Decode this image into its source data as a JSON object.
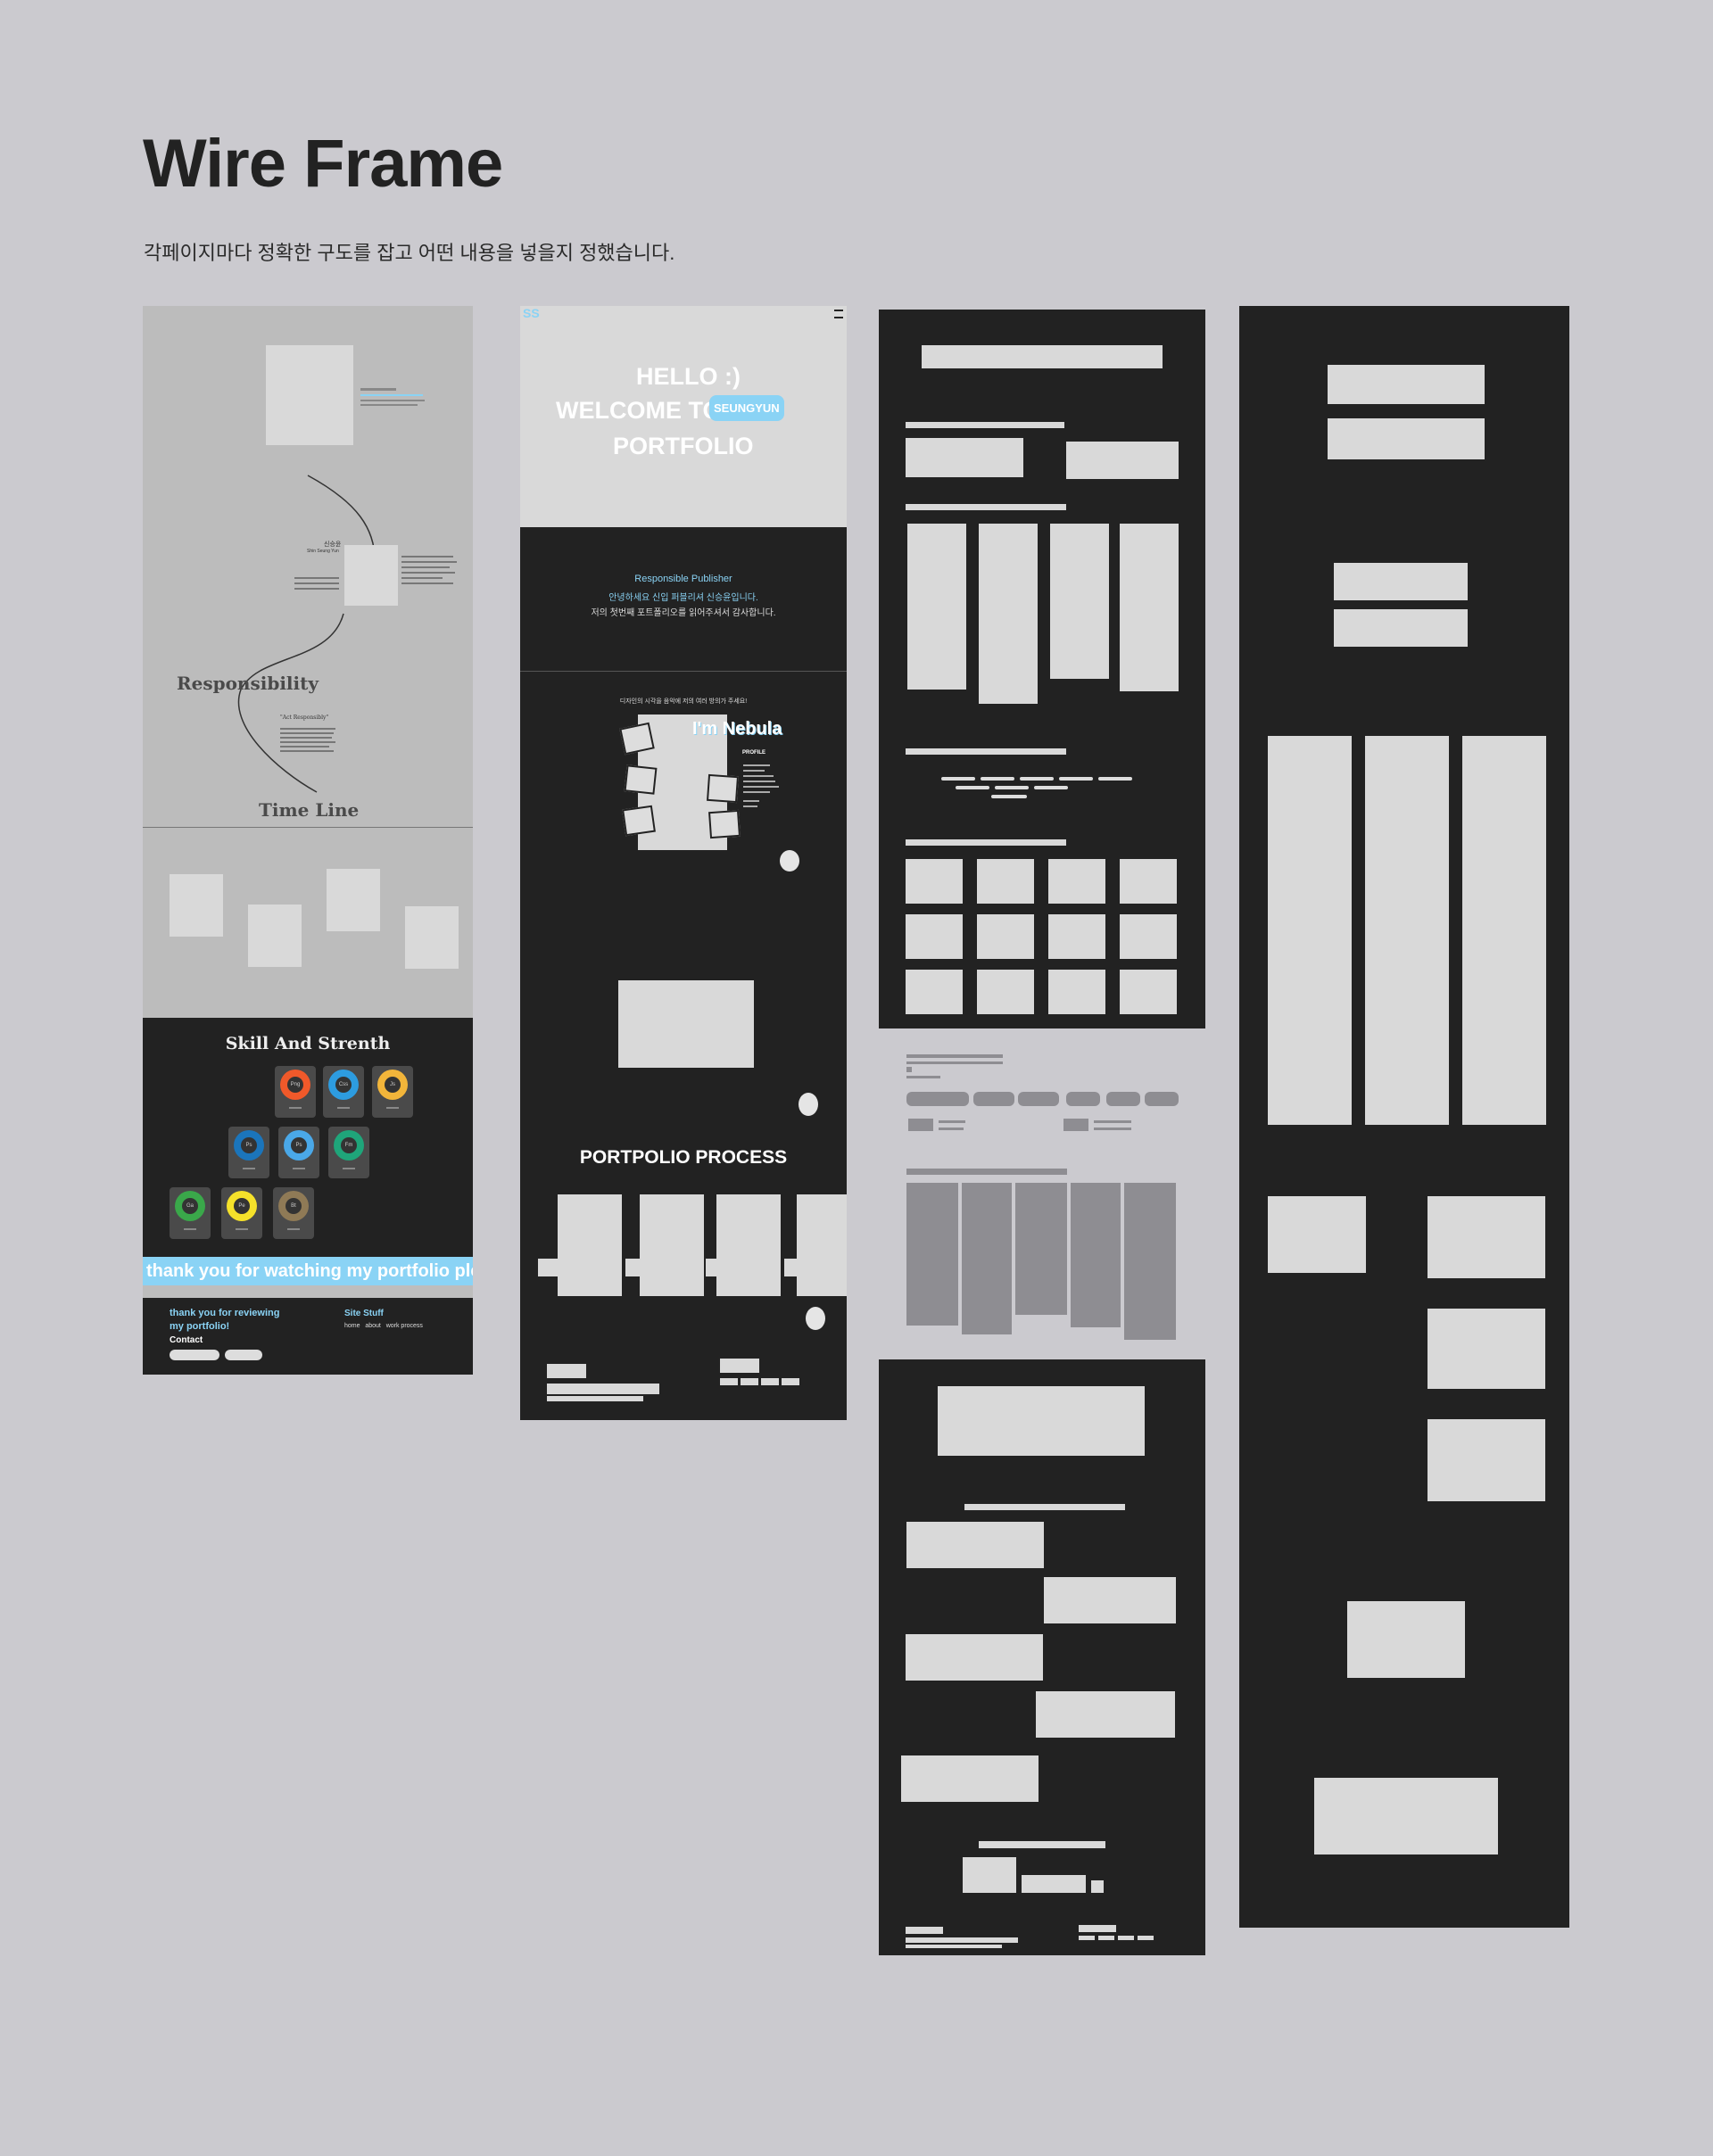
{
  "header": {
    "title": "Wire Frame",
    "subtitle": "각페이지마다 정확한 구도를 잡고 어떤 내용을 넣을지 정했습니다."
  },
  "frame1": {
    "name_ko": "신승윤",
    "name_en": "Shin Seung Yun",
    "responsibility_heading": "Responsibility",
    "quote": "\"Act Responsibly\"",
    "timeline_heading": "Time Line",
    "skill_heading": "Skill And Strenth",
    "marquee": "thank you for watching my portfolio ple",
    "footer_thanks": "thank you for reviewing my portfolio!",
    "footer_contact": "Contact",
    "footer_site": "Site Stuff",
    "footer_links": "home   about   work process"
  },
  "frame2": {
    "logo": "SS",
    "hello": "HELLO :)",
    "welcome": "WELCOME TO",
    "badge": "SEUNGYUN",
    "portfolio": "PORTFOLIO",
    "role": "Responsible Publisher",
    "intro1": "안녕하세요 신입 퍼블리셔 신승윤입니다.",
    "intro2": "저의 첫번째 포트폴리오를 읽어주셔서 감사합니다.",
    "tagline": "디자인의 시각을 음악에 저의 여러 방의가 주세요!",
    "nebula": "I'm Nebula",
    "profile": "PROFILE",
    "process_heading": "PORTPOLIO PROCESS"
  },
  "skills": [
    {
      "abbr": "Png",
      "color": "#f0592a"
    },
    {
      "abbr": "Css",
      "color": "#2d9ce0"
    },
    {
      "abbr": "Js",
      "color": "#f2b53a"
    },
    {
      "abbr": "Ps",
      "color": "#1b75bb"
    },
    {
      "abbr": "Ps",
      "color": "#4aa8e8"
    },
    {
      "abbr": "Fm",
      "color": "#1fa57a"
    },
    {
      "abbr": "Ga",
      "color": "#3aa84a"
    },
    {
      "abbr": "Pe",
      "color": "#f5e12a"
    },
    {
      "abbr": "Bt",
      "color": "#8f7a56"
    }
  ],
  "colors": {
    "background": "#cbcacf",
    "dark": "#222222",
    "placeholder": "#d9d9d9",
    "accent": "#8ad3f5"
  }
}
